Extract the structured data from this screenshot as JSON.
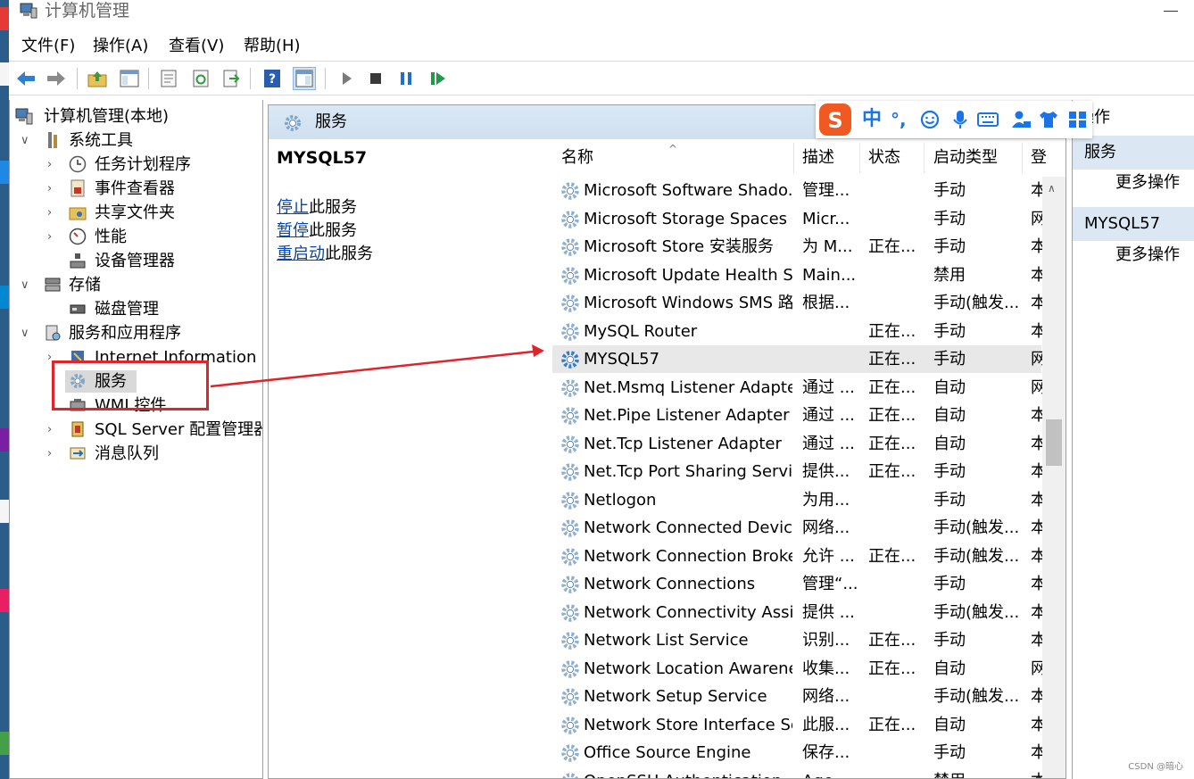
{
  "window": {
    "title": "计算机管理"
  },
  "menu": [
    {
      "label": "文件(F)"
    },
    {
      "label": "操作(A)"
    },
    {
      "label": "查看(V)"
    },
    {
      "label": "帮助(H)"
    }
  ],
  "tree": {
    "root": "计算机管理(本地)",
    "system_tools": "系统工具",
    "task_scheduler": "任务计划程序",
    "event_viewer": "事件查看器",
    "shared_folders": "共享文件夹",
    "performance": "性能",
    "device_manager": "设备管理器",
    "storage": "存储",
    "disk_management": "磁盘管理",
    "services_apps": "服务和应用程序",
    "iis": "Internet Information Se",
    "services": "服务",
    "wmi": "WMI 控件",
    "sql_server": "SQL Server 配置管理器",
    "message_queue": "消息队列"
  },
  "services_panel": {
    "header": "服务",
    "selected_name": "MYSQL57",
    "actions": [
      {
        "link": "停止",
        "text": "此服务"
      },
      {
        "link": "暂停",
        "text": "此服务"
      },
      {
        "link": "重启动",
        "text": "此服务"
      }
    ]
  },
  "columns": {
    "name": "名称",
    "desc": "描述",
    "status": "状态",
    "startup": "启动类型",
    "logon": "登"
  },
  "services": [
    {
      "name": "Microsoft Software Shado...",
      "desc": "管理...",
      "status": "",
      "startup": "手动",
      "logon": "本"
    },
    {
      "name": "Microsoft Storage Spaces S...",
      "desc": "Micr...",
      "status": "",
      "startup": "手动",
      "logon": "网"
    },
    {
      "name": "Microsoft Store 安装服务",
      "desc": "为 M...",
      "status": "正在...",
      "startup": "手动",
      "logon": "本"
    },
    {
      "name": "Microsoft Update Health S...",
      "desc": "Main...",
      "status": "",
      "startup": "禁用",
      "logon": "本"
    },
    {
      "name": "Microsoft Windows SMS 路...",
      "desc": "根据...",
      "status": "",
      "startup": "手动(触发...",
      "logon": "本"
    },
    {
      "name": "MySQL Router",
      "desc": "",
      "status": "正在...",
      "startup": "手动",
      "logon": "本"
    },
    {
      "name": "MYSQL57",
      "desc": "",
      "status": "正在...",
      "startup": "手动",
      "logon": "网"
    },
    {
      "name": "Net.Msmq Listener Adapter",
      "desc": "通过 ...",
      "status": "正在...",
      "startup": "自动",
      "logon": "网"
    },
    {
      "name": "Net.Pipe Listener Adapter",
      "desc": "通过 ...",
      "status": "正在...",
      "startup": "自动",
      "logon": "本"
    },
    {
      "name": "Net.Tcp Listener Adapter",
      "desc": "通过 ...",
      "status": "正在...",
      "startup": "自动",
      "logon": "本"
    },
    {
      "name": "Net.Tcp Port Sharing Service",
      "desc": "提供...",
      "status": "正在...",
      "startup": "手动",
      "logon": "本"
    },
    {
      "name": "Netlogon",
      "desc": "为用...",
      "status": "",
      "startup": "手动",
      "logon": "本"
    },
    {
      "name": "Network Connected Devic...",
      "desc": "网络...",
      "status": "",
      "startup": "手动(触发...",
      "logon": "本"
    },
    {
      "name": "Network Connection Broker",
      "desc": "允许 ...",
      "status": "正在...",
      "startup": "手动(触发...",
      "logon": "本"
    },
    {
      "name": "Network Connections",
      "desc": "管理“...",
      "status": "",
      "startup": "手动",
      "logon": "本"
    },
    {
      "name": "Network Connectivity Assis...",
      "desc": "提供 ...",
      "status": "",
      "startup": "手动(触发...",
      "logon": "本"
    },
    {
      "name": "Network List Service",
      "desc": "识别...",
      "status": "正在...",
      "startup": "手动",
      "logon": "本"
    },
    {
      "name": "Network Location Awarene...",
      "desc": "收集...",
      "status": "正在...",
      "startup": "自动",
      "logon": "网"
    },
    {
      "name": "Network Setup Service",
      "desc": "网络...",
      "status": "",
      "startup": "手动(触发...",
      "logon": "本"
    },
    {
      "name": "Network Store Interface Se...",
      "desc": "此服...",
      "status": "正在...",
      "startup": "自动",
      "logon": "本"
    },
    {
      "name": "Office  Source Engine",
      "desc": "保存...",
      "status": "",
      "startup": "手动",
      "logon": "本"
    },
    {
      "name": "OpenSSH Authentication ...",
      "desc": "Age...",
      "status": "",
      "startup": "禁用",
      "logon": "本"
    }
  ],
  "actions_pane": {
    "title": "操作",
    "section1": "服务",
    "more1": "更多操作",
    "section2": "MYSQL57",
    "more2": "更多操作"
  },
  "ime": {
    "mode": "中",
    "punct": "°,"
  },
  "watermark": "CSDN @暗心",
  "colors": {
    "accent_red": "#e0242a",
    "header_blue": "#dae8f5",
    "link": "#0645ad"
  }
}
